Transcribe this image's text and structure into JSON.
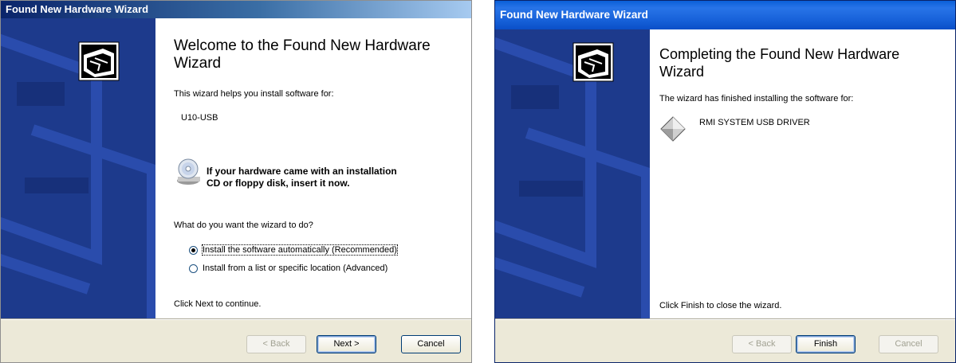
{
  "left": {
    "title": "Found New Hardware Wizard",
    "heading": "Welcome to the Found New Hardware Wizard",
    "intro": "This wizard helps you install software for:",
    "device": "U10-USB",
    "cd_notice": "If your hardware came with an installation CD or floppy disk, insert it now.",
    "question": "What do you want the wizard to do?",
    "options": [
      {
        "label": "Install the software automatically (Recommended)",
        "selected": true
      },
      {
        "label": "Install from a list or specific location (Advanced)",
        "selected": false
      }
    ],
    "hint": "Click Next to continue.",
    "buttons": {
      "back": "< Back",
      "next": "Next >",
      "cancel": "Cancel"
    }
  },
  "right": {
    "title": "Found New Hardware Wizard",
    "heading": "Completing the Found New Hardware Wizard",
    "intro": "The wizard has finished installing the software for:",
    "device": "RMI SYSTEM USB DRIVER",
    "hint": "Click Finish to close the wizard.",
    "buttons": {
      "back": "< Back",
      "finish": "Finish",
      "cancel": "Cancel"
    }
  },
  "icons": {
    "wizard_logo": "hardware-wizard-icon",
    "cd": "cd-drive-icon",
    "device": "device-diamond-icon"
  },
  "colors": {
    "sidebar": "#1d3a8c",
    "classic_title_start": "#0a246a",
    "xp_title": "#1660d8",
    "face": "#ece9d8"
  }
}
